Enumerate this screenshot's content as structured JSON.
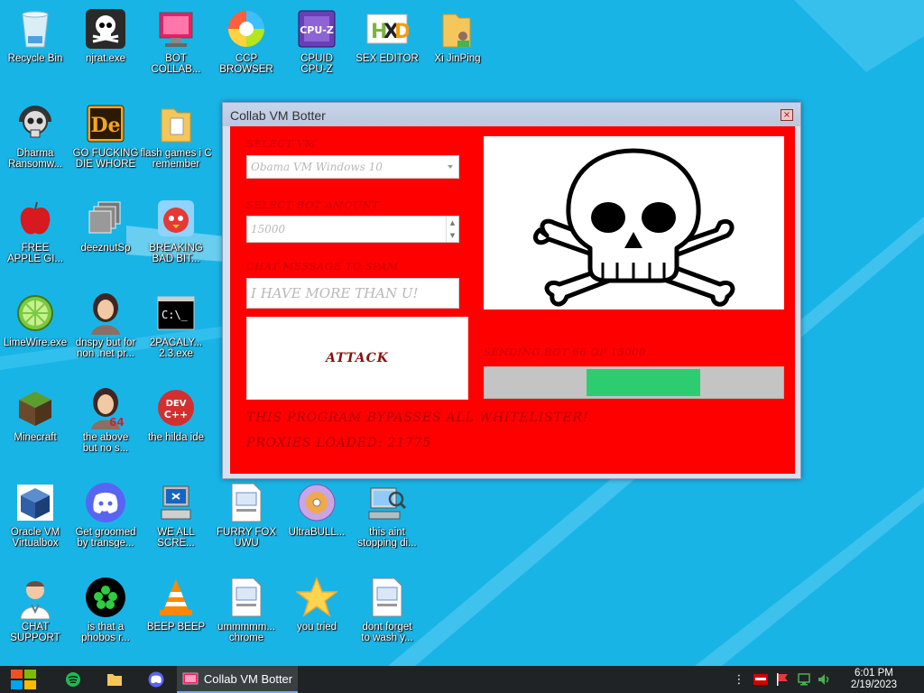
{
  "desktop": {
    "icons": [
      {
        "id": "recycle-bin",
        "label": "Recycle Bin",
        "icon": "recycle-bin-icon"
      },
      {
        "id": "njrat",
        "label": "njrat.exe",
        "icon": "skull-icon"
      },
      {
        "id": "bot-collab",
        "label": "BOT\nCOLLAB...",
        "icon": "monitor-icon"
      },
      {
        "id": "ccp-browser",
        "label": "CCP\nBROWSER",
        "icon": "browser-icon"
      },
      {
        "id": "cpuz",
        "label": "CPUID\nCPU-Z",
        "icon": "cpu-icon"
      },
      {
        "id": "sex-editor",
        "label": "SEX EDITOR",
        "icon": "hex-editor-icon"
      },
      {
        "id": "xi-jinping",
        "label": "Xi JinPing",
        "icon": "folder-user-icon"
      },
      {
        "id": "dharma",
        "label": "Dharma\nRansomw...",
        "icon": "skull-headphones-icon"
      },
      {
        "id": "go-die",
        "label": "GO FUCKING\nDIE WHORE",
        "icon": "de-app-icon"
      },
      {
        "id": "flash-games",
        "label": "flash games i C\nremember",
        "icon": "folder-icon"
      },
      {
        "id": "free-apple",
        "label": "FREE\nAPPLE GI...",
        "icon": "apple-icon"
      },
      {
        "id": "deeznut",
        "label": "deeznutSp",
        "icon": "windows-stack-icon"
      },
      {
        "id": "breaking-bad",
        "label": "BREAKING\nBAD BIT...",
        "icon": "angry-bird-icon"
      },
      {
        "id": "limewire",
        "label": "LimeWire.exe",
        "icon": "lime-icon"
      },
      {
        "id": "dnspy",
        "label": "dnspy but for\nnon .net pr...",
        "icon": "portrait-icon"
      },
      {
        "id": "pacaly",
        "label": "2PACALY...\n2.3.exe",
        "icon": "terminal-icon"
      },
      {
        "id": "minecraft",
        "label": "Minecraft",
        "icon": "minecraft-icon"
      },
      {
        "id": "the-above",
        "label": "the above\nbut no s...",
        "icon": "portrait-64-icon"
      },
      {
        "id": "hilda-ide",
        "label": "the hilda ide",
        "icon": "devcpp-icon"
      },
      {
        "id": "virtualbox",
        "label": "Oracle VM\nVirtualbox",
        "icon": "virtualbox-icon"
      },
      {
        "id": "discord-groomed",
        "label": "Get groomed\nby transge...",
        "icon": "discord-icon"
      },
      {
        "id": "we-all-scream",
        "label": "WE ALL\nSCRE...",
        "icon": "computer-icon"
      },
      {
        "id": "furry-fox",
        "label": "FURRY FOX\nUWU",
        "icon": "document-icon"
      },
      {
        "id": "ultrabull",
        "label": "UltraBULL...",
        "icon": "disc-icon"
      },
      {
        "id": "this-aint",
        "label": "this aint\nstopping di...",
        "icon": "search-computer-icon"
      },
      {
        "id": "chat-support",
        "label": "CHAT\nSUPPORT",
        "icon": "doctor-icon"
      },
      {
        "id": "phobos",
        "label": "is that a\nphobos r...",
        "icon": "cicada-icon"
      },
      {
        "id": "beep-beep",
        "label": "BEEP BEEP",
        "icon": "vlc-icon"
      },
      {
        "id": "chrome-doc",
        "label": "ummmmm...\nchrome",
        "icon": "document-icon"
      },
      {
        "id": "you-tried",
        "label": "you tried",
        "icon": "star-icon"
      },
      {
        "id": "wash",
        "label": "dont forget\nto wash y...",
        "icon": "document-icon"
      }
    ]
  },
  "window": {
    "title": "Collab VM Botter",
    "close_symbol": "×",
    "select_vm_label": "SELECT VM",
    "select_vm_value": "Obama VM Windows 10",
    "bot_amount_label": "SELECT BOT AMOUNT",
    "bot_amount_value": "15000",
    "chat_label": "CHAT MESSAGE TO SPAM",
    "chat_value": "I HAVE MORE THAN U!",
    "attack_label": "ATTACK",
    "status_text": "SENDING BOT 66 OF 15000",
    "progress": {
      "start": 0.34,
      "end": 0.72
    },
    "bypass_text": "THIS PROGRAM BYPASSES ALL WHITELISTER!",
    "proxies_text": "PROXIES LOADED: 21775"
  },
  "taskbar": {
    "app_label": "Collab VM Botter",
    "time": "6:01 PM",
    "date": "2/19/2023"
  },
  "colors": {
    "desktop": "#19b4e6",
    "window_client": "#ff0000",
    "progress_fill": "#2ecc71",
    "taskbar": "#1f2326"
  }
}
